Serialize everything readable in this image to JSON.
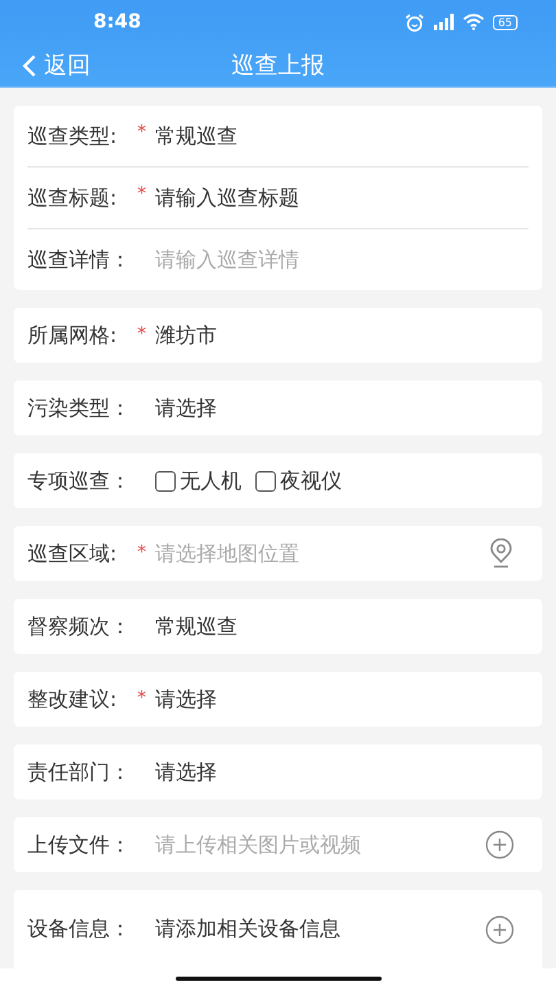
{
  "status_bar": {
    "time": "8:48",
    "battery": "65"
  },
  "nav": {
    "back": "返回",
    "title": "巡查上报"
  },
  "groups": [
    [
      {
        "kind": "text",
        "label": "巡查类型:",
        "required_mark": "*",
        "value": "常规巡查"
      },
      {
        "kind": "text",
        "label": "巡查标题:",
        "required_mark": "*",
        "value": "请输入巡查标题"
      },
      {
        "kind": "text",
        "label": "巡查详情：",
        "placeholder": "请输入巡查详情"
      }
    ],
    [
      {
        "kind": "text",
        "label": "所属网格:",
        "required_mark": "*",
        "value": "潍坊市"
      }
    ],
    [
      {
        "kind": "text",
        "label": "污染类型：",
        "value": "请选择"
      }
    ],
    [
      {
        "kind": "checkboxes",
        "label": "专项巡查：",
        "options": [
          {
            "label": "无人机",
            "checked": false
          },
          {
            "label": "夜视仪",
            "checked": false
          }
        ]
      }
    ],
    [
      {
        "kind": "text",
        "label": "巡查区域:",
        "required_mark": "*",
        "placeholder": "请选择地图位置",
        "trailing": {
          "kind": "location"
        }
      }
    ],
    [
      {
        "kind": "text",
        "label": "督察频次：",
        "value": "常规巡查"
      }
    ],
    [
      {
        "kind": "text",
        "label": "整改建议:",
        "required_mark": "*",
        "value": "请选择"
      }
    ],
    [
      {
        "kind": "text",
        "label": "责任部门：",
        "value": "请选择"
      }
    ],
    [
      {
        "kind": "text",
        "label": "上传文件：",
        "placeholder": "请上传相关图片或视频",
        "trailing": {
          "kind": "add"
        }
      }
    ],
    [
      {
        "kind": "text",
        "label": "设备信息：",
        "value": "请添加相关设备信息",
        "trailing": {
          "kind": "add"
        }
      }
    ]
  ]
}
